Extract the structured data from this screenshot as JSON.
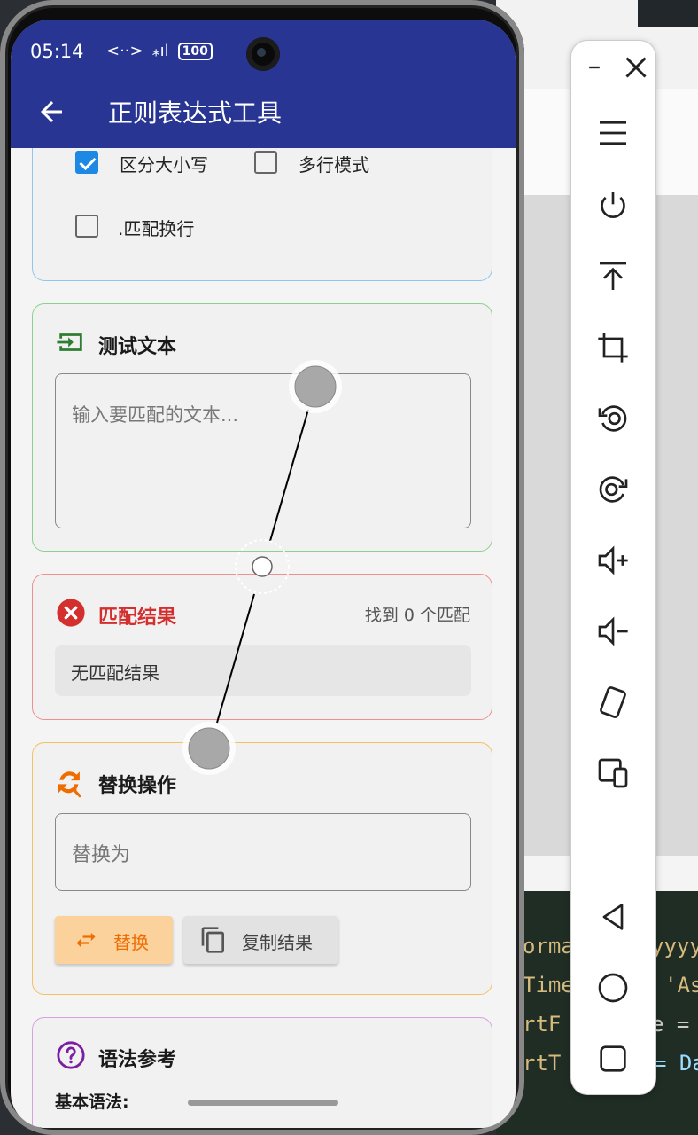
{
  "status_bar": {
    "time": "05:14",
    "battery": "100"
  },
  "app_bar": {
    "title": "正则表达式工具"
  },
  "options": {
    "case_sensitive": {
      "label": "区分大小写",
      "checked": true
    },
    "multiline": {
      "label": "多行模式",
      "checked": false
    },
    "dotall": {
      "label": ".匹配换行",
      "checked": false
    }
  },
  "test_text": {
    "title": "测试文本",
    "placeholder": "输入要匹配的文本..."
  },
  "match_result": {
    "title": "匹配结果",
    "count": "找到 0 个匹配",
    "empty": "无匹配结果"
  },
  "replace": {
    "title": "替换操作",
    "placeholder": "替换为",
    "replace_button": "替换",
    "copy_button": "复制结果"
  },
  "syntax": {
    "title": "语法参考",
    "basic": "基本语法:"
  },
  "colors": {
    "app_bar": "#283593",
    "checkbox": "#1e88e5",
    "test_accent": "#2e7d32",
    "error": "#d32f2f",
    "replace_accent": "#ef6c00",
    "syntax_accent": "#7b1fa2"
  },
  "code_fragments": [
    "orma",
    "yyyy",
    "Time",
    "'As",
    "rtF",
    "e =",
    "rtT",
    "= Da"
  ],
  "emulator_controls": [
    "minimize-icon",
    "close-icon",
    "menu-icon",
    "power-icon",
    "top-icon",
    "crop-icon",
    "rotate-left-icon",
    "rotate-right-icon",
    "volume-up-icon",
    "volume-down-icon",
    "fold-icon",
    "device-icon",
    "back-icon",
    "home-icon",
    "overview-icon"
  ]
}
